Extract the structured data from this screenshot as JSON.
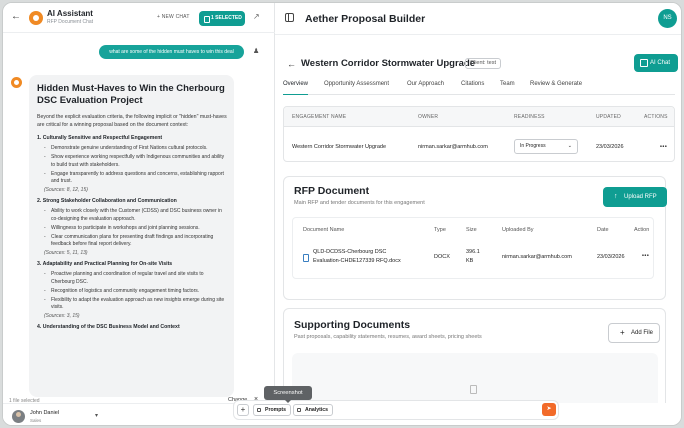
{
  "chat": {
    "title": "AI Assistant",
    "subtitle": "RFP Document Chat",
    "new_chat": "+ NEW CHAT",
    "selected_btn": "1 SELECTED",
    "user_message": "what are some of the hidden must haves to win this deal",
    "answer": {
      "title": "Hidden Must-Haves to Win the Cherbourg DSC Evaluation Project",
      "intro": "Beyond the explicit evaluation criteria, the following implicit or \"hidden\" must-haves are critical for a winning proposal based on the document context:",
      "sections": [
        {
          "heading": "1. Culturally Sensitive and Respectful Engagement",
          "bullets": [
            "Demonstrate genuine understanding of First Nations cultural protocols.",
            "Show experience working respectfully with Indigenous communities and ability to build trust with stakeholders.",
            "Engage transparently to address questions and concerns, establishing rapport and trust."
          ],
          "sources": "(Sources: 8, 12, 15)"
        },
        {
          "heading": "2. Strong Stakeholder Collaboration and Communication",
          "bullets": [
            "Ability to work closely with the Customer (CDSS) and DSC business owner in co-designing the evaluation approach.",
            "Willingness to participate in workshops and joint planning sessions.",
            "Clear communication plans for presenting draft findings and incorporating feedback before final report delivery."
          ],
          "sources": "(Sources: 5, 11, 13)"
        },
        {
          "heading": "3. Adaptability and Practical Planning for On-site Visits",
          "bullets": [
            "Proactive planning and coordination of regular travel and site visits to Cherbourg DSC.",
            "Recognition of logistics and community engagement timing factors.",
            "Flexibility to adapt the evaluation approach as new insights emerge during site visits."
          ],
          "sources": "(Sources: 3, 15)"
        },
        {
          "heading": "4. Understanding of the DSC Business Model and Context",
          "bullets": [],
          "sources": ""
        }
      ]
    },
    "file_selected": "1 file selected",
    "user": {
      "name": "John Daniel",
      "role": "Sales"
    }
  },
  "app": {
    "title": "Aether Proposal Builder",
    "avatar_initials": "NS",
    "project_title": "Western Corridor Stormwater Upgrade",
    "client_tag": "Client: test",
    "ai_chat_btn": "AI Chat",
    "tabs": [
      "Overview",
      "Opportunity Assessment",
      "Our Approach",
      "Citations",
      "Team",
      "Review & Generate"
    ]
  },
  "engagement": {
    "headers": [
      "ENGAGEMENT NAME",
      "OWNER",
      "READINESS",
      "UPDATED",
      "ACTIONS"
    ],
    "name": "Western Corridor Stormwater Upgrade",
    "owner": "nirman.sarkar@armhub.com",
    "readiness": "In Progress",
    "updated": "23/03/2026",
    "actions": "•••"
  },
  "rfp": {
    "title": "RFP Document",
    "subtitle": "Main RFP and tender documents for this engagement",
    "upload_btn": "Upload RFP",
    "headers": [
      "Document Name",
      "Type",
      "Size",
      "Uploaded By",
      "Date",
      "Action"
    ],
    "doc_name_line1": "QLD-DCDSS-Cherbourg DSC",
    "doc_name_line2": "Evaluation-CHDE127339 RFQ.docx",
    "type": "DOCX",
    "size_line1": "396.1",
    "size_line2": "KB",
    "uploaded_by": "nirman.sarkar@armhub.com",
    "date": "23/03/2026",
    "action": "•••"
  },
  "supporting": {
    "title": "Supporting Documents",
    "subtitle": "Past proposals, capability statements, resumes, award sheets, pricing sheets",
    "add_btn": "Add File"
  },
  "prompt_bar": {
    "change": "Change",
    "prompts": "Prompts",
    "analytics": "Analytics",
    "tooltip": "Screenshot"
  },
  "colors": {
    "accent": "#0f9d92",
    "brand_orange": "#f08a24",
    "send": "#f26b2a"
  }
}
